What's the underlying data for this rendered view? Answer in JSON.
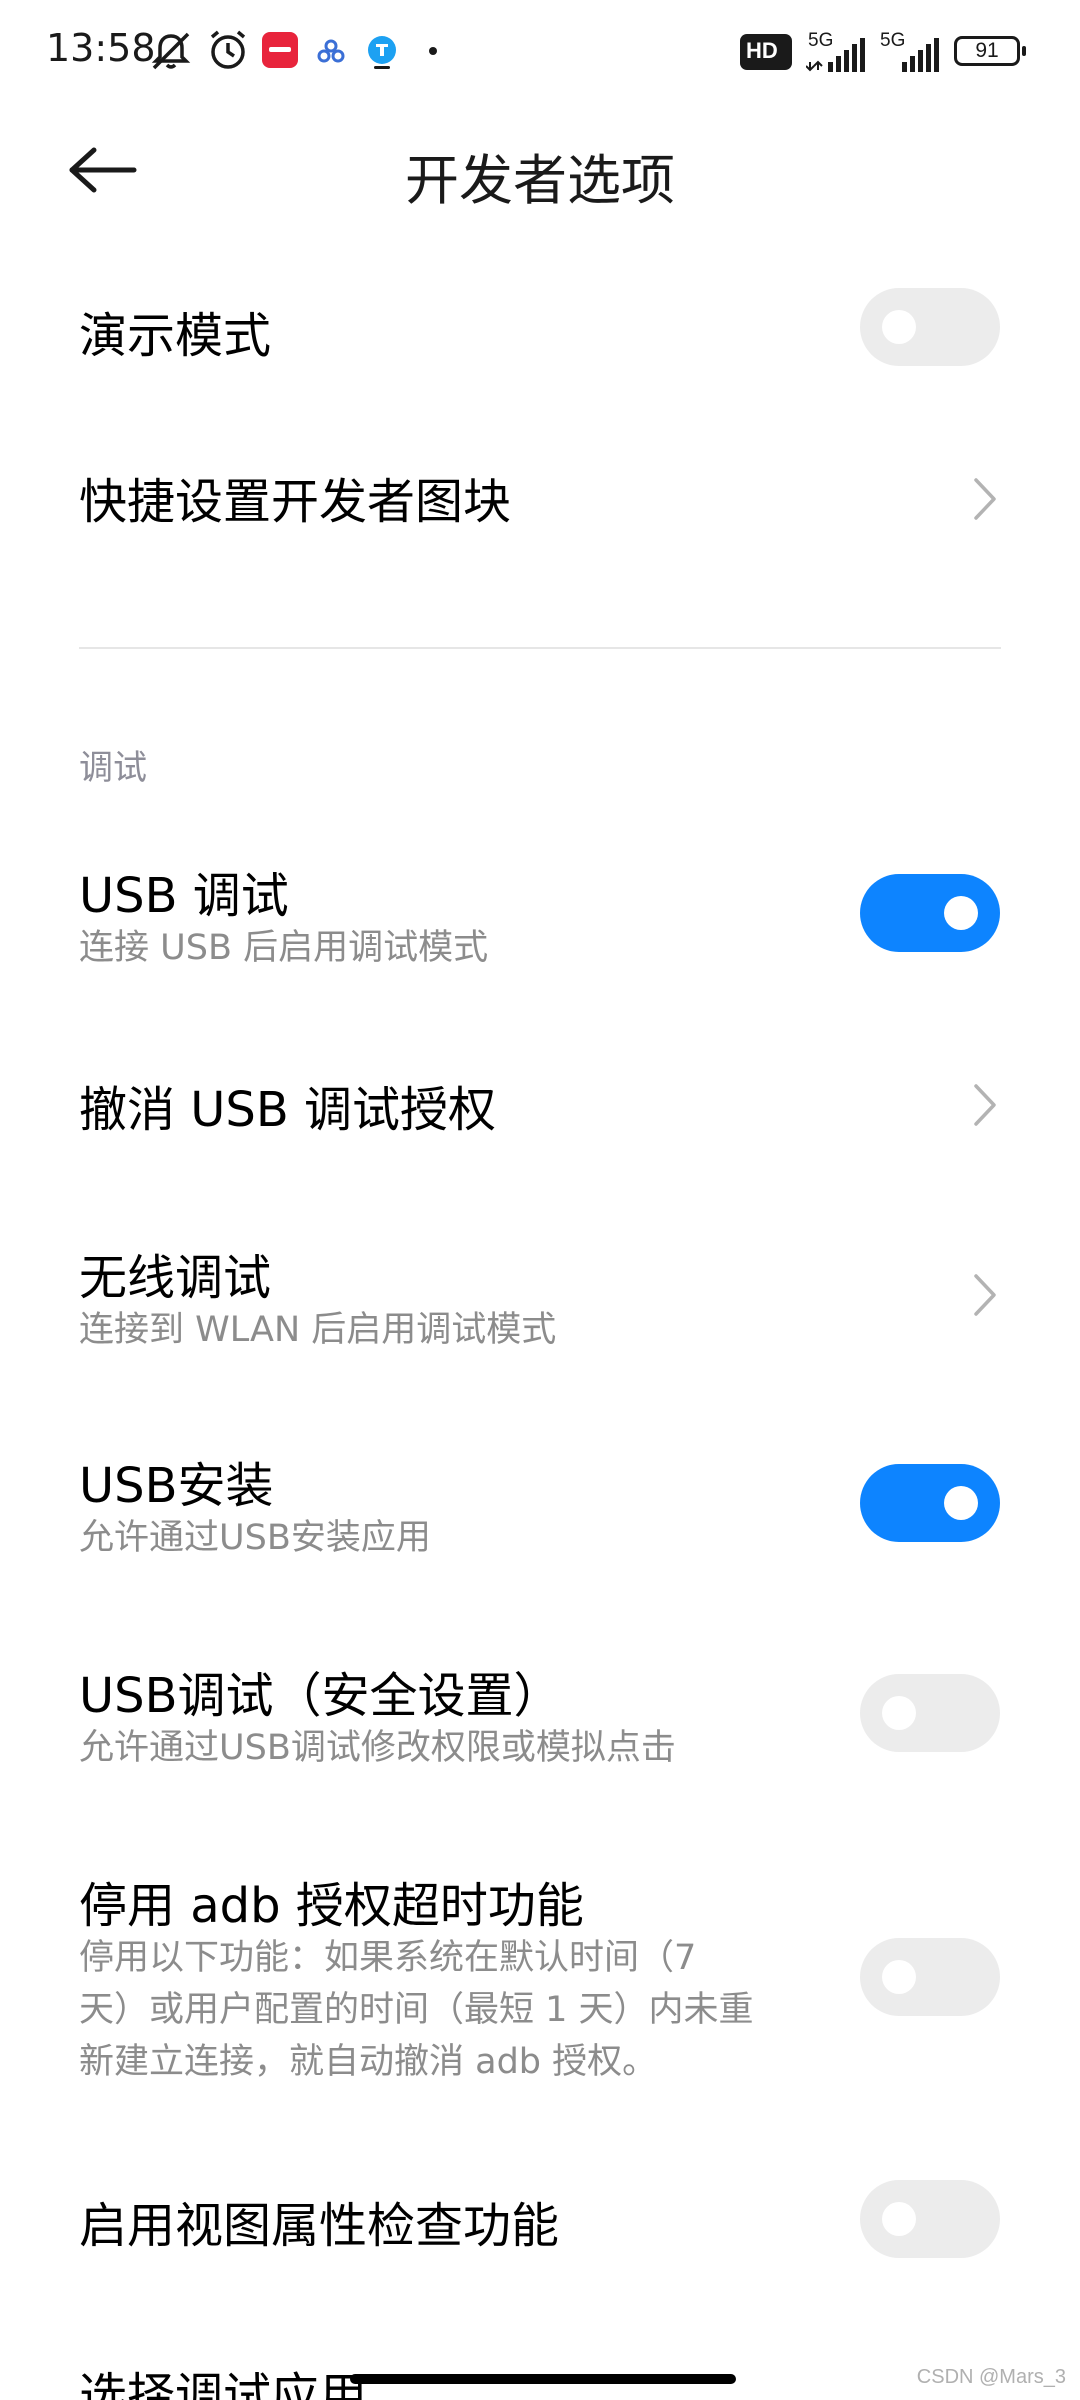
{
  "status_bar": {
    "time": "13:58",
    "battery": "91",
    "network_1": "5G",
    "network_2": "5G",
    "hd_label": "HD"
  },
  "header": {
    "title": "开发者选项"
  },
  "rows": {
    "demo_mode": {
      "title": "演示模式",
      "toggle": "off"
    },
    "quick_tiles": {
      "title": "快捷设置开发者图块"
    },
    "section_debug": "调试",
    "usb_debug": {
      "title": "USB 调试",
      "subtitle": "连接 USB 后启用调试模式",
      "toggle": "on"
    },
    "revoke_usb": {
      "title": "撤消 USB 调试授权"
    },
    "wireless_debug": {
      "title": "无线调试",
      "subtitle": "连接到 WLAN 后启用调试模式"
    },
    "usb_install": {
      "title": "USB安装",
      "subtitle": "允许通过USB安装应用",
      "toggle": "on"
    },
    "usb_debug_security": {
      "title": "USB调试（安全设置）",
      "subtitle": "允许通过USB调试修改权限或模拟点击",
      "toggle": "off"
    },
    "adb_timeout": {
      "title": "停用 adb 授权超时功能",
      "subtitle_lines": [
        "停用以下功能：如果系统在默认时间（7",
        "天）或用户配置的时间（最短 1 天）内未重",
        "新建立连接，就自动撤消 adb 授权。"
      ],
      "toggle": "off"
    },
    "view_attr": {
      "title": "启用视图属性检查功能",
      "toggle": "off"
    },
    "select_debug_app": {
      "title": "选择调试应用"
    }
  },
  "watermark": "CSDN @Mars_3",
  "colors": {
    "accent": "#0d84ff",
    "toggle_off": "#ececec",
    "subtitle": "#8c8c8c",
    "section": "#8e8e99"
  }
}
